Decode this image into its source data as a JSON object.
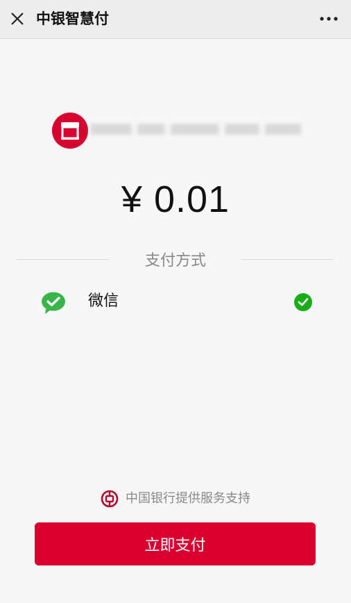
{
  "header": {
    "title": "中银智慧付",
    "close_icon": "close-icon",
    "more_icon": "more-icon"
  },
  "merchant": {
    "logo_icon": "store-icon",
    "logo_color": "#d6042e"
  },
  "payment": {
    "amount": "¥ 0.01",
    "method_label": "支付方式",
    "options": [
      {
        "label": "微信",
        "icon": "wechat-icon",
        "selected": true
      }
    ]
  },
  "footer": {
    "provider_icon": "bank-of-china-icon",
    "provider_text": "中国银行提供服务支持",
    "pay_button_label": "立即支付",
    "button_color": "#d9002f"
  }
}
